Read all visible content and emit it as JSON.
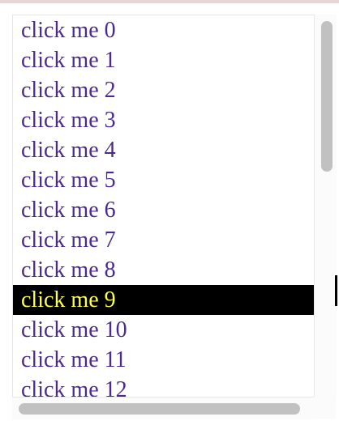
{
  "listbox": {
    "selected_index": 9,
    "items": [
      {
        "label": "click me 0"
      },
      {
        "label": "click me 1"
      },
      {
        "label": "click me 2"
      },
      {
        "label": "click me 3"
      },
      {
        "label": "click me 4"
      },
      {
        "label": "click me 5"
      },
      {
        "label": "click me 6"
      },
      {
        "label": "click me 7"
      },
      {
        "label": "click me 8"
      },
      {
        "label": "click me 9"
      },
      {
        "label": "click me 10"
      },
      {
        "label": "click me 11"
      },
      {
        "label": "click me 12"
      }
    ]
  },
  "colors": {
    "item_text": "#4b2a8c",
    "selected_background": "#000000",
    "selected_text": "#ffff4d",
    "scroll_thumb": "#c1c1c1"
  }
}
